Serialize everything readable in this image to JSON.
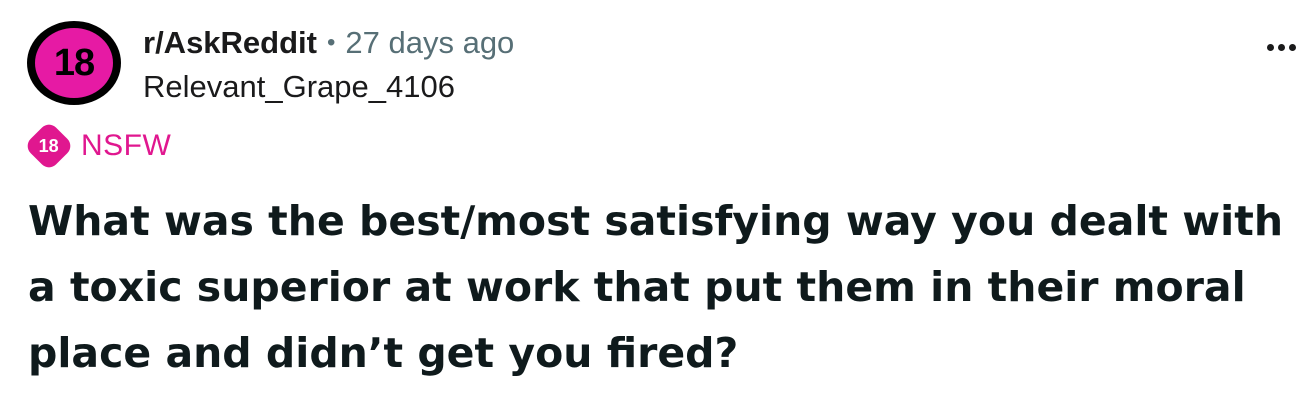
{
  "header": {
    "avatar_text": "18",
    "subreddit": "r/AskReddit",
    "separator": "•",
    "time_ago": "27 days ago",
    "author": "Relevant_Grape_4106",
    "more_icon": "more-horizontal-icon"
  },
  "flair": {
    "badge_text": "18",
    "label": "NSFW",
    "color": "#e0178f"
  },
  "post": {
    "title": "What was the best/most satisfying way you dealt with a toxic superior at work that put them in their moral place and didn’t get you fired?"
  },
  "colors": {
    "avatar_bg": "#e61aa4",
    "avatar_ring": "#000000",
    "meta_gray": "#576f76",
    "text": "#1a1a1b"
  }
}
